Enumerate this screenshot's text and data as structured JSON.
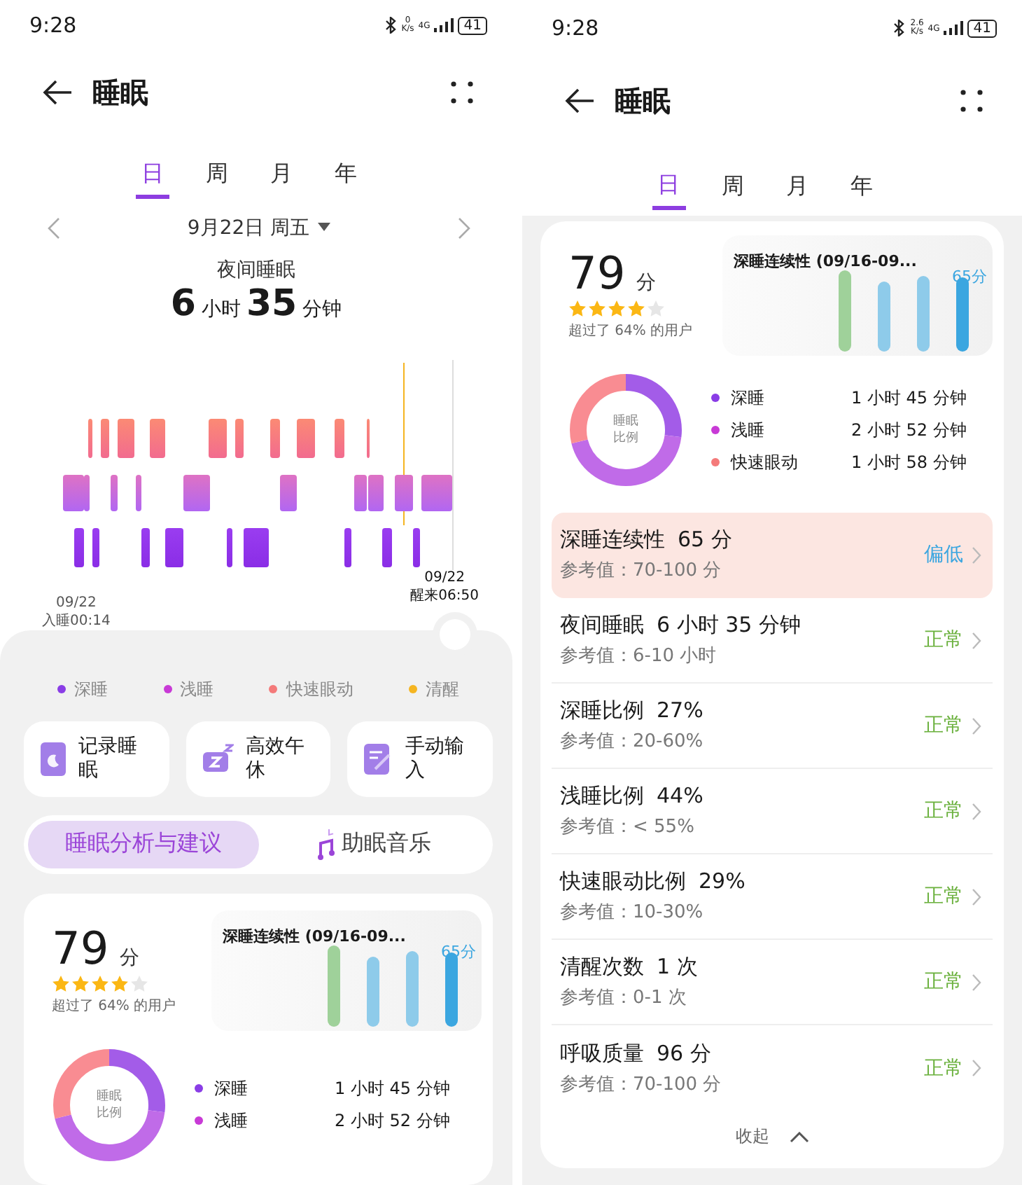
{
  "screens": [
    {
      "status_bar": {
        "time": "9:28",
        "speed_value": "0",
        "speed_unit": "K/s",
        "network": "4G",
        "battery": "41"
      },
      "header": {
        "title": "睡眠"
      },
      "period_tabs": [
        {
          "label": "日",
          "selected": true
        },
        {
          "label": "周",
          "selected": false
        },
        {
          "label": "月",
          "selected": false
        },
        {
          "label": "年",
          "selected": false
        }
      ],
      "date_nav": {
        "date": "9月22日 周五"
      },
      "summary": {
        "label": "夜间睡眠",
        "hours": "6",
        "hours_unit": "小时",
        "minutes": "35",
        "minutes_unit": "分钟"
      },
      "hypnogram": {
        "start_date": "09/22",
        "start_label": "入睡00:14",
        "end_date": "09/22",
        "end_label": "醒来06:50"
      },
      "legend": [
        {
          "label": "深睡",
          "color": "#8a3de6"
        },
        {
          "label": "浅睡",
          "color": "#c83ad6"
        },
        {
          "label": "快速眼动",
          "color": "#f47a7a"
        },
        {
          "label": "清醒",
          "color": "#f5b521"
        }
      ],
      "actions": [
        {
          "label": "记录睡眠"
        },
        {
          "label": "高效午休"
        },
        {
          "label": "手动输入"
        }
      ],
      "segments": [
        {
          "label": "睡眠分析与建议",
          "selected": true
        },
        {
          "label": "助眠音乐",
          "selected": false
        }
      ],
      "score_card": {
        "score": "79",
        "unit": "分",
        "stars": 4,
        "percentile": "超过了 64% 的用户",
        "continuity_title": "深睡连续性 (09/16-09...",
        "continuity_value": "65分",
        "ratio_label": [
          "睡眠",
          "比例"
        ],
        "stages": [
          {
            "label": "深睡",
            "duration": "1 小时 45 分钟",
            "color": "#8a3de6"
          },
          {
            "label": "浅睡",
            "duration": "2 小时 52 分钟",
            "color": "#c83ad6"
          }
        ]
      }
    },
    {
      "status_bar": {
        "time": "9:28",
        "speed_value": "2.6",
        "speed_unit": "K/s",
        "network": "4G",
        "battery": "41"
      },
      "header": {
        "title": "睡眠"
      },
      "period_tabs": [
        {
          "label": "日",
          "selected": true
        },
        {
          "label": "周",
          "selected": false
        },
        {
          "label": "月",
          "selected": false
        },
        {
          "label": "年",
          "selected": false
        }
      ],
      "score_card": {
        "score": "79",
        "unit": "分",
        "stars": 4,
        "percentile": "超过了 64% 的用户",
        "continuity_title": "深睡连续性 (09/16-09...",
        "continuity_value": "65分",
        "ratio_label": [
          "睡眠",
          "比例"
        ],
        "stages": [
          {
            "label": "深睡",
            "duration": "1 小时 45 分钟",
            "color": "#8a3de6"
          },
          {
            "label": "浅睡",
            "duration": "2 小时 52 分钟",
            "color": "#c83ad6"
          },
          {
            "label": "快速眼动",
            "duration": "1 小时 58 分钟",
            "color": "#f47a7a"
          }
        ],
        "metrics": [
          {
            "name": "深睡连续性",
            "value": "65 分",
            "reference": "参考值：70-100 分",
            "status": "偏低",
            "flagged": true
          },
          {
            "name": "夜间睡眠",
            "value": "6 小时 35 分钟",
            "reference": "参考值：6-10 小时",
            "status": "正常",
            "flagged": false
          },
          {
            "name": "深睡比例",
            "value": "27%",
            "reference": "参考值：20-60%",
            "status": "正常",
            "flagged": false
          },
          {
            "name": "浅睡比例",
            "value": "44%",
            "reference": "参考值：< 55%",
            "status": "正常",
            "flagged": false
          },
          {
            "name": "快速眼动比例",
            "value": "29%",
            "reference": "参考值：10-30%",
            "status": "正常",
            "flagged": false
          },
          {
            "name": "清醒次数",
            "value": "1 次",
            "reference": "参考值：0-1 次",
            "status": "正常",
            "flagged": false
          },
          {
            "name": "呼吸质量",
            "value": "96 分",
            "reference": "参考值：70-100 分",
            "status": "正常",
            "flagged": false
          }
        ],
        "collapse_label": "收起"
      }
    }
  ]
}
